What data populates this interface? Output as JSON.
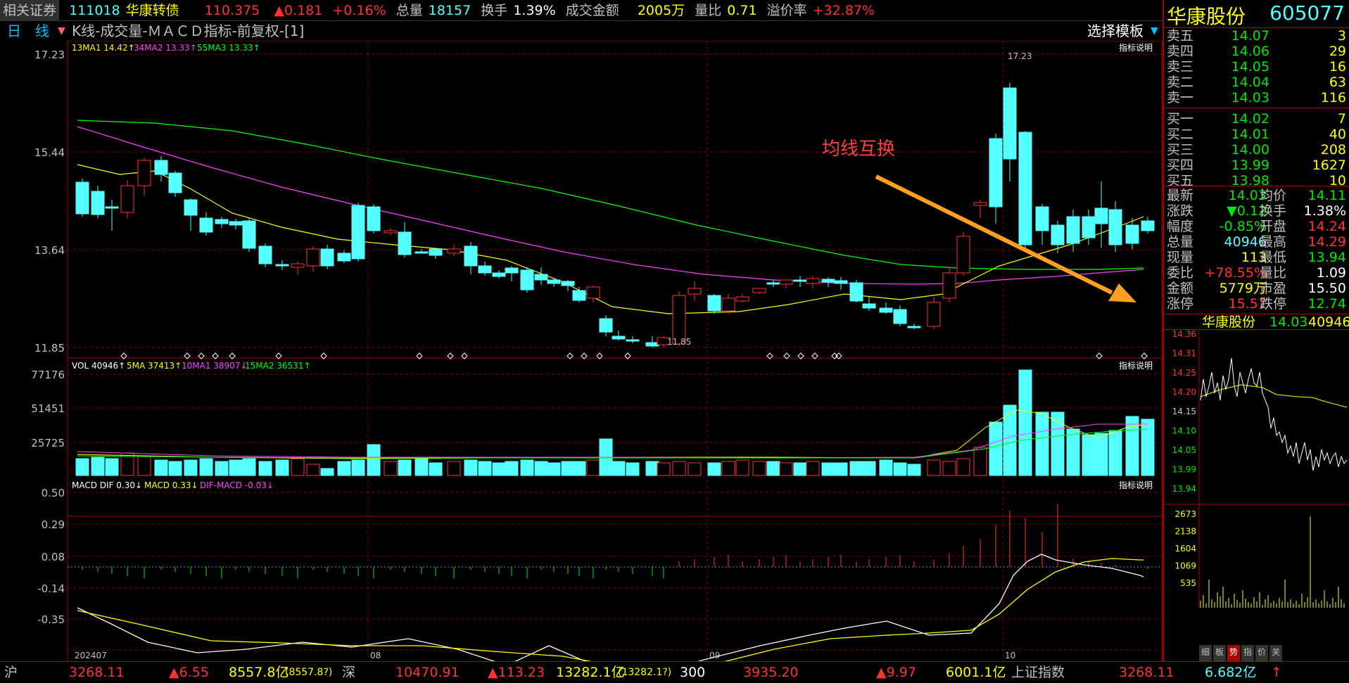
{
  "topbar": {
    "related_label": "相关证券",
    "bond_code": "111018",
    "bond_name": "华康转债",
    "bond_price": "110.375",
    "bond_change": "▲0.181",
    "bond_pct": "+0.16%",
    "total_vol_label": "总量",
    "total_vol": "18157",
    "turnover_label": "换手",
    "turnover": "1.39%",
    "amount_label": "成交金额",
    "amount": "2005万",
    "vol_ratio_label": "量比",
    "vol_ratio": "0.71",
    "premium_label": "溢价率",
    "premium": "+32.87%"
  },
  "subbar": {
    "period": "日　线",
    "indicators": "K线-成交量-ＭＡＣＤ指标-前复权-[1]",
    "template_label": "选择模板"
  },
  "main_panel": {
    "ma1": "13MA1 14.42↑",
    "ma2": "34MA2 13.33↑",
    "ma3": "55MA3 13.33↑",
    "explain": "指标说明",
    "y_ticks": [
      "17.23",
      "15.44",
      "13.64",
      "11.85"
    ],
    "high_label": "17.23",
    "low_label": "11.85",
    "annotation": "均线互换"
  },
  "volume_panel": {
    "vol": "VOL 40946↑",
    "ma5": "5MA 37413↑",
    "ma10": "10MA1 38907↓",
    "ma15": "15MA2 36531↑",
    "explain": "指标说明",
    "y_ticks": [
      "77176",
      "51451",
      "25725"
    ]
  },
  "macd_panel": {
    "dif": "MACD DIF 0.30↓",
    "macd": "MACD 0.33↓",
    "difmacd": "DIF-MACD -0.03↓",
    "explain": "指标说明",
    "y_ticks": [
      "0.50",
      "0.29",
      "0.08",
      "-0.14",
      "-0.35"
    ]
  },
  "x_labels": [
    "202407",
    "08",
    "09",
    "10"
  ],
  "right": {
    "name": "华康股份",
    "code": "605077",
    "sells": [
      {
        "label": "卖五",
        "price": "14.07",
        "vol": "3"
      },
      {
        "label": "卖四",
        "price": "14.06",
        "vol": "29"
      },
      {
        "label": "卖三",
        "price": "14.05",
        "vol": "16"
      },
      {
        "label": "卖二",
        "price": "14.04",
        "vol": "63"
      },
      {
        "label": "卖一",
        "price": "14.03",
        "vol": "116"
      }
    ],
    "buys": [
      {
        "label": "买一",
        "price": "14.02",
        "vol": "7"
      },
      {
        "label": "买二",
        "price": "14.01",
        "vol": "40"
      },
      {
        "label": "买三",
        "price": "14.00",
        "vol": "208"
      },
      {
        "label": "买四",
        "price": "13.99",
        "vol": "1627"
      },
      {
        "label": "买五",
        "price": "13.98",
        "vol": "10"
      }
    ],
    "quotes": [
      {
        "l1": "最新",
        "v1": "14.03",
        "l2": "均价",
        "v2": "14.11"
      },
      {
        "l1": "涨跌",
        "v1": "▼0.12",
        "l2": "换手",
        "v2": "1.38%"
      },
      {
        "l1": "幅度",
        "v1": "-0.85%",
        "l2": "开盘",
        "v2": "14.24"
      },
      {
        "l1": "总量",
        "v1": "40946",
        "l2": "最高",
        "v2": "14.29"
      },
      {
        "l1": "现量",
        "v1": "113",
        "l2": "最低",
        "v2": "13.94"
      },
      {
        "l1": "委比",
        "v1": "+78.55%",
        "l2": "量比",
        "v2": "1.09"
      },
      {
        "l1": "金额",
        "v1": "5779万",
        "l2": "市盈",
        "v2": "15.50"
      },
      {
        "l1": "涨停",
        "v1": "15.57",
        "l2": "跌停",
        "v2": "12.74"
      }
    ],
    "mini_title": "华康股份",
    "mini_price": "14.03",
    "mini_vol": "40946",
    "mini_price_ticks": [
      "14.36",
      "14.31",
      "14.25",
      "14.20",
      "14.15",
      "14.10",
      "14.05",
      "13.99",
      "13.94"
    ],
    "mini_vol_ticks": [
      "2673",
      "2138",
      "1604",
      "1069",
      "535"
    ],
    "tabs": [
      "细",
      "板",
      "势",
      "指",
      "价",
      "关"
    ]
  },
  "bottombar": {
    "sh_label": "沪",
    "sh_index": "3268.11",
    "sh_change": "▲6.55",
    "sh_amount": "8557.8亿",
    "sh_amount2": "(8557.8?)",
    "sz_label": "深",
    "sz_index": "10470.91",
    "sz_change": "▲113.23",
    "sz_amount": "13282.1亿",
    "sz_amount2": "(13282.1?)",
    "cy_label": "300",
    "cy_index": "3935.20",
    "cy_change": "▲9.97",
    "cy_amount": "6001.1亿",
    "idx_name": "上证指数",
    "idx_value": "3268.11",
    "idx_amount": "6.682亿",
    "idx_arrow": "↑"
  },
  "colors": {
    "up": "#ff3232",
    "down": "#54ffff",
    "ma1": "#ffff00",
    "ma2": "#ff40ff",
    "ma3": "#00ff00",
    "annotation": "#ff4040",
    "arrow": "#ffa020"
  }
}
